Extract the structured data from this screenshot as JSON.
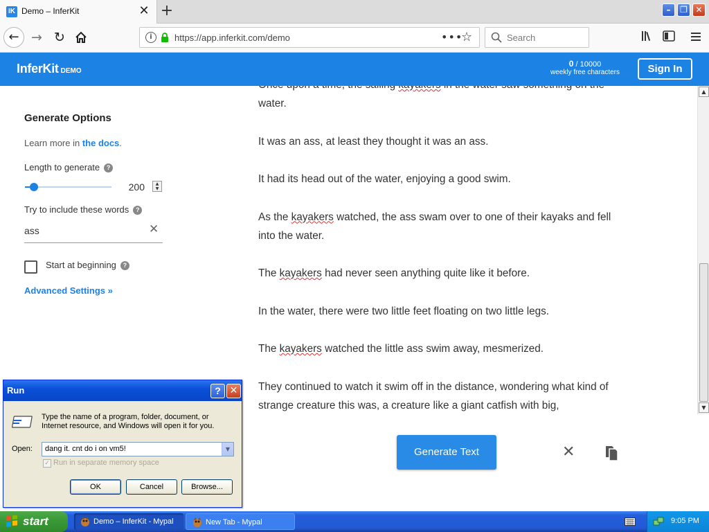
{
  "browser": {
    "tab_title": "Demo – InferKit",
    "favicon_text": "IK",
    "tab_close": "✕",
    "new_tab": "+",
    "url": "https://app.inferkit.com/demo",
    "search_placeholder": "Search",
    "page_actions": "•••"
  },
  "header": {
    "brand": "InferKit",
    "brand_suffix": "DEMO",
    "char_used": "0",
    "char_limit": "/ 10000",
    "char_caption": "weekly free characters",
    "sign_in": "Sign In"
  },
  "sidebar": {
    "title": "Generate Options",
    "docs_prefix": "Learn more in ",
    "docs_link": "the docs",
    "docs_suffix": ".",
    "length_label": "Length to generate",
    "length_value": "200",
    "length_fraction": 0.1,
    "words_label": "Try to include these words",
    "words_value": "ass",
    "start_label": "Start at beginning",
    "advanced": "Advanced Settings »"
  },
  "output": {
    "paragraphs": [
      [
        {
          "t": "Once upon a time, the sailing "
        },
        {
          "t": "kayakers",
          "s": true
        },
        {
          "t": " in the water saw something on the water."
        }
      ],
      [
        {
          "t": "It was an ass, at least they thought it was an ass."
        }
      ],
      [
        {
          "t": "It had its head out of the water, enjoying a good swim."
        }
      ],
      [
        {
          "t": "As the "
        },
        {
          "t": "kayakers",
          "s": true
        },
        {
          "t": " watched, the ass swam over to one of their kayaks and fell into the water."
        }
      ],
      [
        {
          "t": "The "
        },
        {
          "t": "kayakers",
          "s": true
        },
        {
          "t": " had never seen anything quite like it before."
        }
      ],
      [
        {
          "t": "In the water, there were two little feet floating on two little legs."
        }
      ],
      [
        {
          "t": "The "
        },
        {
          "t": "kayakers",
          "s": true
        },
        {
          "t": " watched the little ass swim away, mesmerized."
        }
      ],
      [
        {
          "t": "They continued to watch it swim off in the distance, wondering what kind of strange creature this was, a creature like a giant catfish with big,"
        }
      ]
    ],
    "generate_button": "Generate Text"
  },
  "run_dialog": {
    "title": "Run",
    "description": "Type the name of a program, folder, document, or Internet resource, and Windows will open it for you.",
    "open_label": "Open:",
    "open_value": "dang it. cnt do i on vm5!",
    "memory_label": "Run in separate memory space",
    "ok": "OK",
    "cancel": "Cancel",
    "browse": "Browse..."
  },
  "taskbar": {
    "start": "start",
    "items": [
      "Demo – InferKit - Mypal",
      "New Tab - Mypal"
    ],
    "clock": "9:05 PM"
  },
  "colors": {
    "accent": "#1c82e4",
    "header_bg": "#1c82e4",
    "squiggle": "#dd3333"
  }
}
